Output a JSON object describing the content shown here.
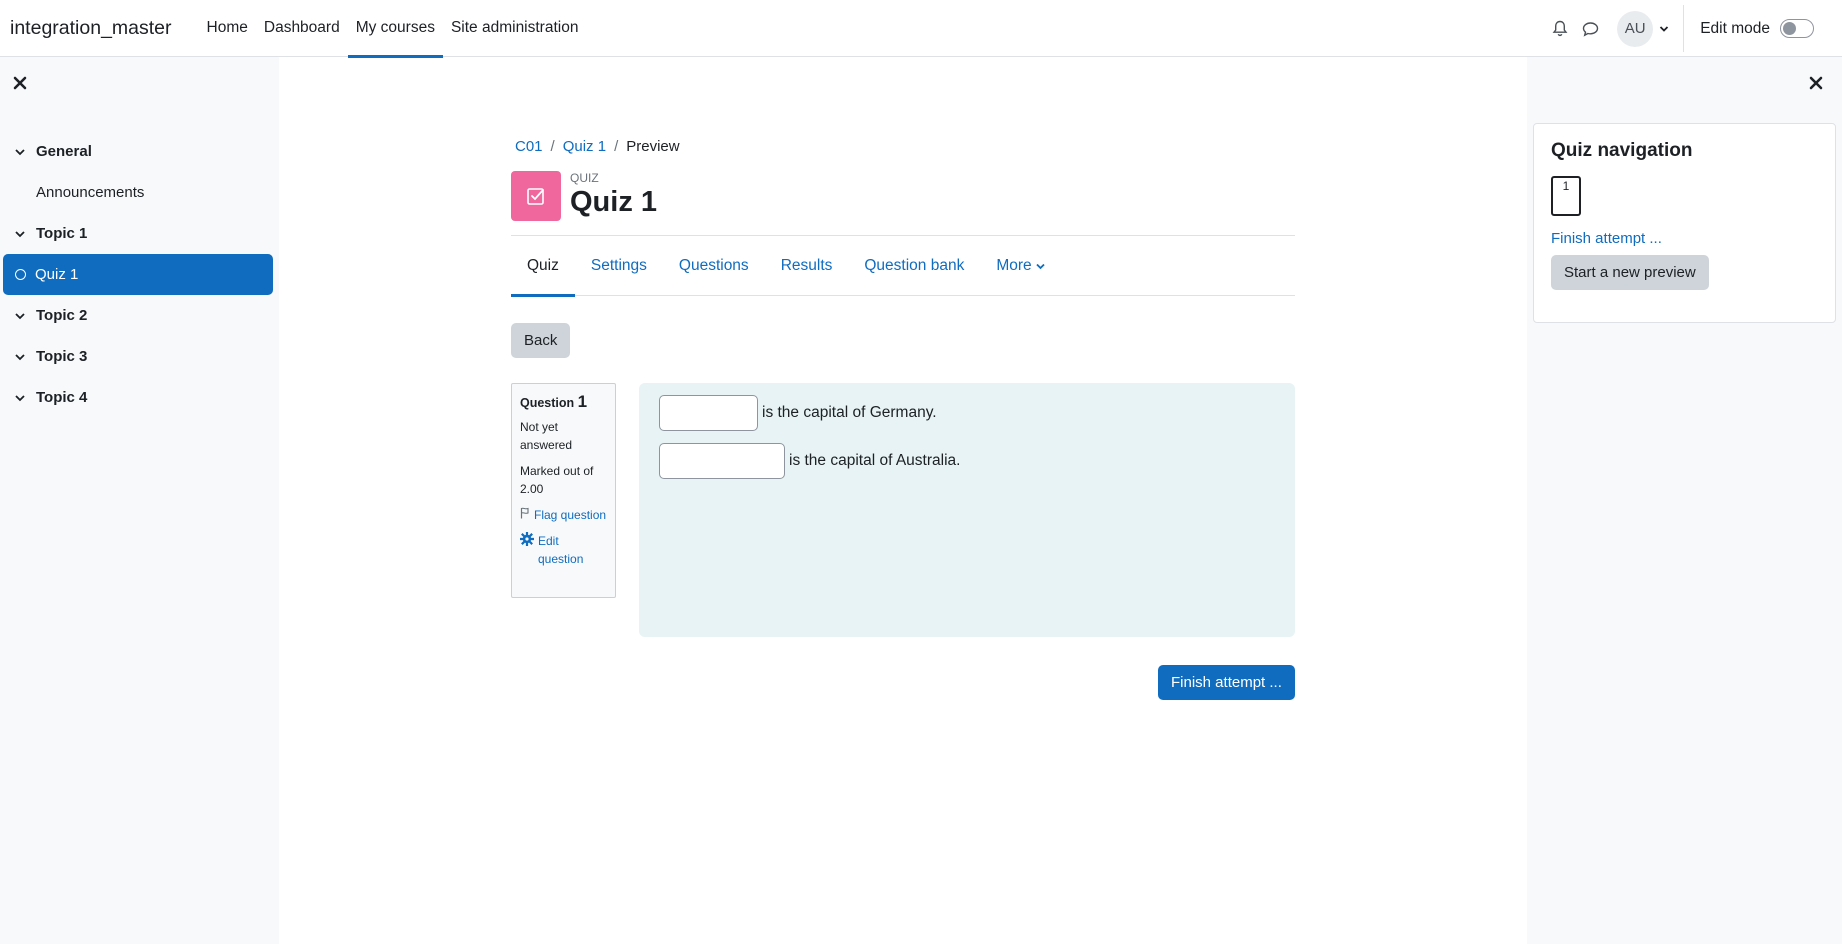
{
  "navbar": {
    "brand": "integration_master",
    "items": [
      {
        "label": "Home",
        "active": false
      },
      {
        "label": "Dashboard",
        "active": false
      },
      {
        "label": "My courses",
        "active": true
      },
      {
        "label": "Site administration",
        "active": false
      }
    ],
    "avatar_initials": "AU",
    "edit_mode_label": "Edit mode",
    "edit_mode_on": false
  },
  "course_index": {
    "sections": [
      {
        "label": "General",
        "items": [
          "Announcements"
        ]
      },
      {
        "label": "Topic 1",
        "items": [
          "Quiz 1"
        ]
      },
      {
        "label": "Topic 2",
        "items": []
      },
      {
        "label": "Topic 3",
        "items": []
      },
      {
        "label": "Topic 4",
        "items": []
      }
    ],
    "active_item": "Quiz 1"
  },
  "breadcrumb": {
    "c01": "C01",
    "quiz": "Quiz 1",
    "current": "Preview",
    "separator": "/"
  },
  "header": {
    "module_label": "QUIZ",
    "title": "Quiz 1",
    "icon_color": "#f0679e"
  },
  "tabs": [
    {
      "label": "Quiz",
      "active": true
    },
    {
      "label": "Settings",
      "active": false
    },
    {
      "label": "Questions",
      "active": false
    },
    {
      "label": "Results",
      "active": false
    },
    {
      "label": "Question bank",
      "active": false
    },
    {
      "label": "More",
      "active": false
    }
  ],
  "back_label": "Back",
  "question": {
    "prefix": "Question",
    "number": "1",
    "state": "Not yet answered",
    "grade": "Marked out of 2.00",
    "flag_label": "Flag question",
    "edit_label": "Edit question",
    "lines": [
      {
        "answer": "",
        "text": "is the capital of Germany."
      },
      {
        "answer": "",
        "text": "is the capital of Australia."
      }
    ]
  },
  "finish_label": "Finish attempt ...",
  "quiz_nav": {
    "title": "Quiz navigation",
    "question_button": "1",
    "finish_link": "Finish attempt ...",
    "new_preview_label": "Start a new preview"
  },
  "help_label": "?",
  "colors": {
    "accent": "#0f6cbf",
    "drawer_bg": "#f8f9fa",
    "question_bg": "#e7f3f5"
  }
}
